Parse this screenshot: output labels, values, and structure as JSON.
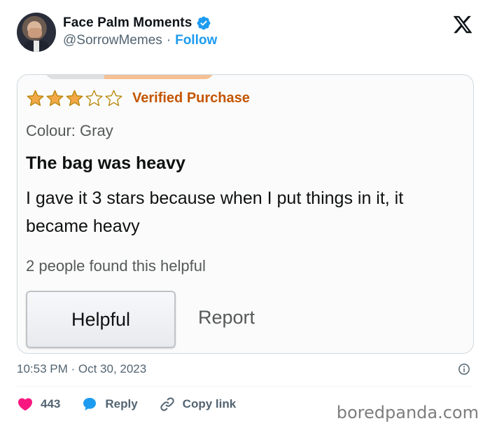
{
  "tweet": {
    "author": {
      "display_name": "Face Palm Moments",
      "handle": "@SorrowMemes",
      "separator": "·",
      "follow_label": "Follow",
      "verified_icon": "verified-badge-icon",
      "avatar_icon": "avatar-facepalm"
    },
    "platform_logo": "x-logo-icon",
    "timestamp": "10:53 PM · Oct 30, 2023",
    "actions": {
      "likes": "443",
      "reply_label": "Reply",
      "copy_link_label": "Copy link"
    },
    "colors": {
      "link_blue": "#1d9bf0",
      "like_pink": "#f91880",
      "reply_blue": "#1d9bf0",
      "muted": "#536471"
    }
  },
  "embedded_review": {
    "rating": 3,
    "rating_max": 5,
    "verified_purchase": "Verified Purchase",
    "colour": "Colour: Gray",
    "title": "The bag was heavy",
    "body": "I gave it 3 stars because when I put things in it, it became heavy",
    "helpful_count": "2 people found this helpful",
    "helpful_button": "Helpful",
    "report_link": "Report",
    "colors": {
      "star_fill": "#f3a847",
      "verified_orange": "#c45500"
    }
  },
  "watermark": "boredpanda.com"
}
